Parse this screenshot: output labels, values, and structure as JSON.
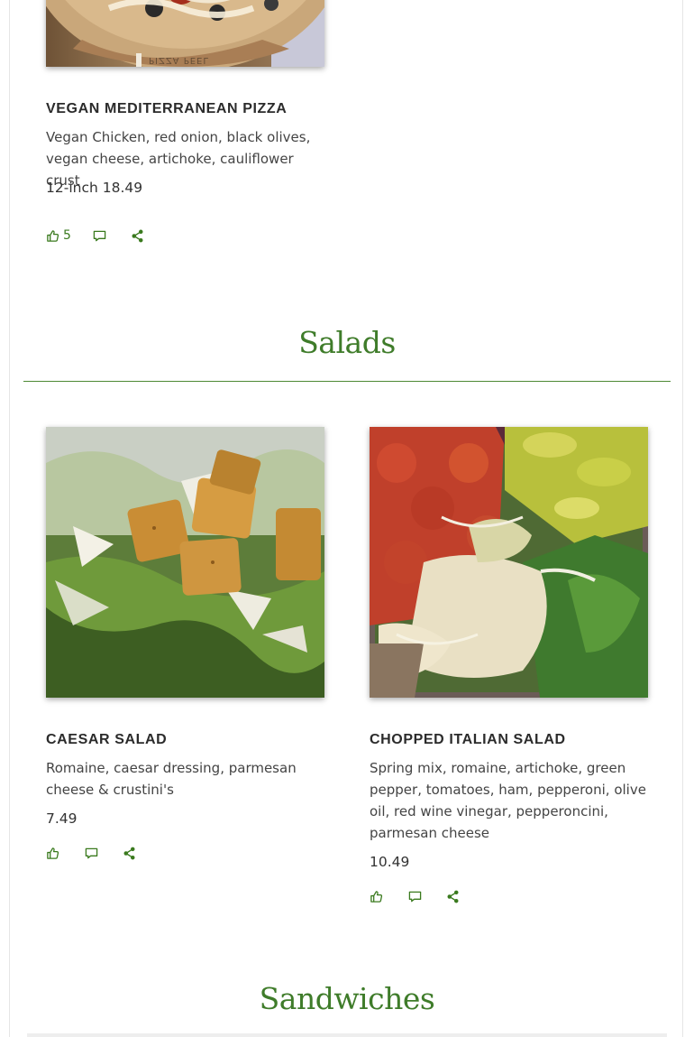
{
  "pizza_section": {
    "items": [
      {
        "title": "VEGAN MEDITERRANEAN PIZZA",
        "description": "Vegan Chicken, red onion,  black olives, vegan cheese, artichoke, cauliflower crust",
        "price": "12-inch 18.49",
        "likes": "5",
        "board_text": "PIZZA PEEL"
      }
    ]
  },
  "salads_section": {
    "heading": "Salads",
    "items": [
      {
        "title": "CAESAR SALAD",
        "description": "Romaine, caesar dressing, parmesan cheese & crustini's",
        "price": "7.49"
      },
      {
        "title": "CHOPPED ITALIAN SALAD",
        "description": "Spring mix, romaine, artichoke, green pepper, tomatoes, ham, pepperoni, olive oil, red wine vinegar, pepperoncini, parmesan cheese",
        "price": "10.49"
      }
    ]
  },
  "sandwiches_section": {
    "heading": "Sandwiches"
  },
  "icons": {
    "like": "thumbs-up-icon",
    "comment": "comment-icon",
    "share": "share-icon"
  },
  "colors": {
    "accent_green": "#3f7c2a",
    "icon_green": "#3a7a1e",
    "title_text": "#2b2b2b",
    "body_text": "#444444"
  }
}
